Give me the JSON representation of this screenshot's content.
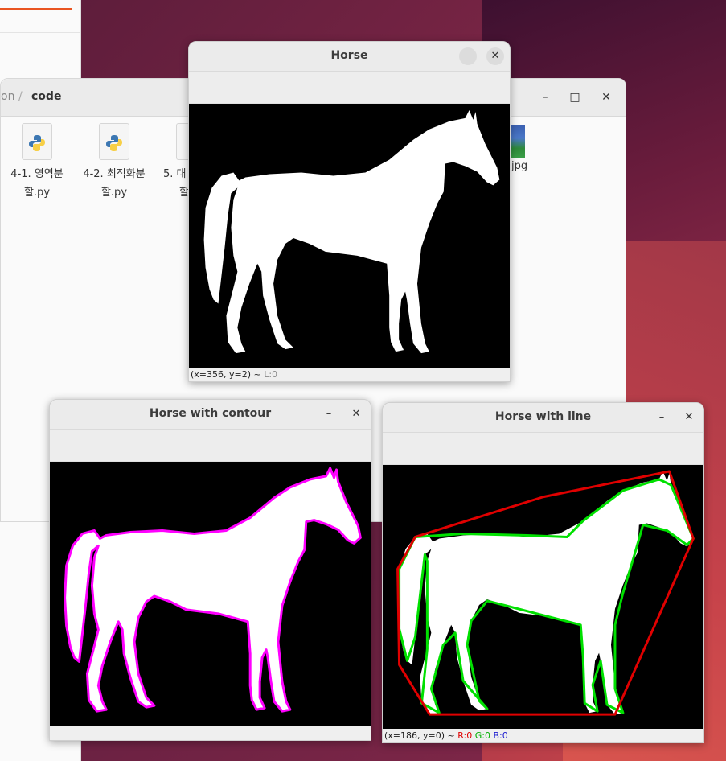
{
  "file_manager": {
    "breadcrumb_prev": "on",
    "breadcrumb_sep": "/",
    "breadcrumb_current": "code",
    "window_buttons": {
      "minimize": "–",
      "maximize": "□",
      "close": "✕"
    },
    "files": [
      {
        "name_line1": "4-1. 영역분",
        "name_line2": "할.py"
      },
      {
        "name_line1": "4-2. 최적화분",
        "name_line2": "할.py"
      },
      {
        "name_line1": "5. 대",
        "name_line2": "할"
      }
    ],
    "image_file_label": "jpg"
  },
  "windows": {
    "horse": {
      "title": "Horse",
      "status": "(x=356, y=2) ~ ",
      "status_l": "L:0",
      "minimize": "–",
      "close": "✕"
    },
    "contour": {
      "title": "Horse with contour",
      "minimize": "–",
      "close": "✕",
      "contour_color": "#ff00ff"
    },
    "line": {
      "title": "Horse with line",
      "minimize": "–",
      "close": "✕",
      "status": "(x=186, y=0) ~ ",
      "status_r": "R:0",
      "status_g": "G:0",
      "status_b": "B:0",
      "hull_color": "#e00000",
      "poly_color": "#00e000"
    }
  }
}
